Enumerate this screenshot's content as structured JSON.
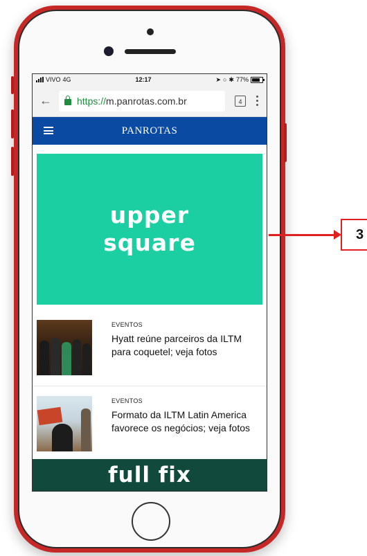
{
  "status_bar": {
    "carrier": "VIVO",
    "network": "4G",
    "time": "12:17",
    "battery": "77%"
  },
  "browser": {
    "url_scheme": "https://",
    "url_host": "m.panrotas.com.br",
    "tab_count": "4"
  },
  "site": {
    "logo": "PANROTAS",
    "header_color": "#0b4aa2"
  },
  "ad_upper": {
    "line1": "upper",
    "line2": "square",
    "color": "#1ccfa2"
  },
  "articles": [
    {
      "category": "EVENTOS",
      "headline": "Hyatt reúne parceiros da ILTM para coquetel; veja fotos"
    },
    {
      "category": "EVENTOS",
      "headline": "Formato da ILTM Latin America favorece os negócios; veja fotos"
    }
  ],
  "ad_fullfix": {
    "text": "full fix",
    "color": "#114a3c"
  },
  "callout": {
    "label": "3",
    "color": "#e02020"
  }
}
